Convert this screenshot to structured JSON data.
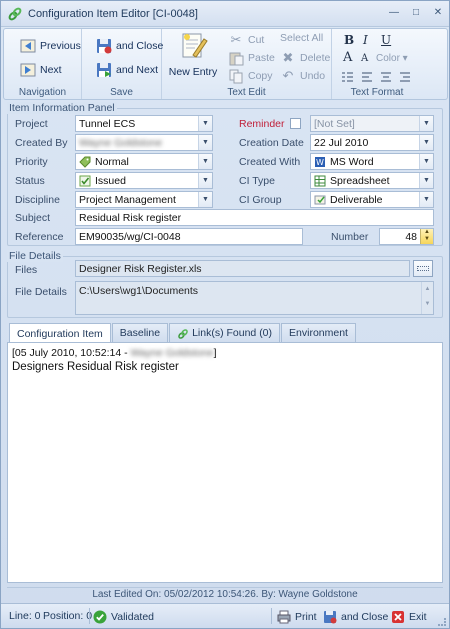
{
  "window": {
    "title": "Configuration Item Editor [CI-0048]"
  },
  "ribbon": {
    "navigation": {
      "previous": "Previous",
      "next": "Next",
      "label": "Navigation"
    },
    "save": {
      "and_close": "and Close",
      "and_next": "and Next",
      "label": "Save"
    },
    "edit": {
      "new_entry": "New Entry",
      "cut": "Cut",
      "paste": "Paste",
      "copy": "Copy",
      "select_all": "Select All",
      "delete": "Delete",
      "undo": "Undo",
      "label": "Text Edit"
    },
    "format": {
      "bold": "B",
      "italic": "I",
      "underline": "U",
      "font": "A",
      "font_size": "A",
      "color": "Color",
      "label": "Text Format"
    }
  },
  "info_panel": {
    "title": "Item Information Panel",
    "project_label": "Project",
    "project_value": "Tunnel ECS",
    "reminder_label": "Reminder",
    "reminder_value": "[Not Set]",
    "created_by_label": "Created By",
    "created_by_value": "Wayne Goldstone",
    "creation_date_label": "Creation Date",
    "creation_date_value": "22 Jul 2010",
    "priority_label": "Priority",
    "priority_value": "Normal",
    "created_with_label": "Created With",
    "created_with_value": "MS Word",
    "status_label": "Status",
    "status_value": "Issued",
    "ci_type_label": "CI Type",
    "ci_type_value": "Spreadsheet",
    "discipline_label": "Discipline",
    "discipline_value": "Project Management",
    "ci_group_label": "CI Group",
    "ci_group_value": "Deliverable",
    "subject_label": "Subject",
    "subject_value": "Residual Risk register",
    "reference_label": "Reference",
    "reference_value": "EM90035/wg/CI-0048",
    "number_label": "Number",
    "number_value": "48"
  },
  "file_panel": {
    "title": "File Details",
    "files_label": "Files",
    "files_value": "Designer Risk Register.xls",
    "file_details_label": "File Details",
    "file_details_value": "C:\\Users\\wg1\\Documents"
  },
  "tabs": [
    {
      "label": "Configuration Item"
    },
    {
      "label": "Baseline"
    },
    {
      "label": "Link(s) Found (0)"
    },
    {
      "label": "Environment"
    }
  ],
  "editor": {
    "header_prefix": "[05 July 2010, 10:52:14 - ",
    "header_author": "Wayne Goldstone",
    "header_suffix": "]",
    "body": "Designers Residual Risk register"
  },
  "footer": {
    "last_edited": "Last Edited On: 05/02/2012 10:54:26. By: Wayne Goldstone"
  },
  "statusbar": {
    "line": "Line: 0",
    "position": "Position: 0",
    "validated": "Validated",
    "print": "Print",
    "and_close": "and Close",
    "exit": "Exit"
  },
  "colors": {
    "accent": "#1e395b",
    "reminder": "#c0203a",
    "validated": "#3aa33a"
  }
}
